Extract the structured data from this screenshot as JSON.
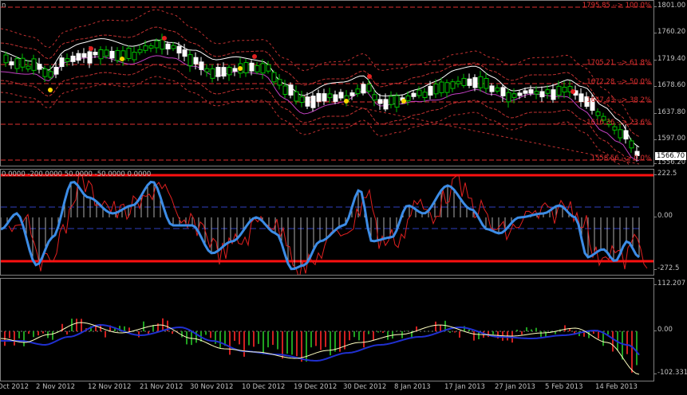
{
  "main_chart": {
    "title_fragment": "n",
    "price_axis": [
      "1801.00",
      "1760.20",
      "1719.40",
      "1678.60",
      "1637.80",
      "1597.00",
      "1556.20"
    ],
    "current_price": "1566.70",
    "fib_levels": [
      {
        "label": "1795.85 --> 100.0%"
      },
      {
        "label": "1705.21 --> 61.8%"
      },
      {
        "label": "1672.28 --> 50.0%"
      },
      {
        "label": "1647.43 --> 38.2%"
      },
      {
        "label": "1616.36 --> 23.6%"
      },
      {
        "label": "1558.56 --> 0.0%"
      }
    ]
  },
  "cci_panel": {
    "levels_label": "0.0000 -200.0000 50.0000 -50.0000 0.0000",
    "axis": [
      "222.5",
      "0.00",
      "-272.5"
    ]
  },
  "macd_panel": {
    "axis": [
      "112.207",
      "0.00",
      "-102.331"
    ]
  },
  "time_axis": [
    "Oct 2012",
    "2 Nov 2012",
    "12 Nov 2012",
    "21 Nov 2012",
    "30 Nov 2012",
    "10 Dec 2012",
    "19 Dec 2012",
    "30 Dec 2012",
    "8 Jan 2013",
    "17 Jan 2013",
    "27 Jan 2013",
    "5 Feb 2013",
    "14 Feb 2013"
  ],
  "colors": {
    "background": "#000000",
    "bull_candle": "#ffffff",
    "bear_candle": "#00c000",
    "ma_white": "#ffffff",
    "ma_magenta": "#c040c0",
    "envelope": "#c03030",
    "fib_red": "#e03030",
    "cci_blue": "#3c8ce6",
    "cci_red": "#e02020",
    "macd_green": "#20a020",
    "macd_red": "#d02020",
    "macd_white": "#ffffc0",
    "macd_blue": "#2030d0"
  },
  "icons": [
    "price-marker-icon"
  ]
}
